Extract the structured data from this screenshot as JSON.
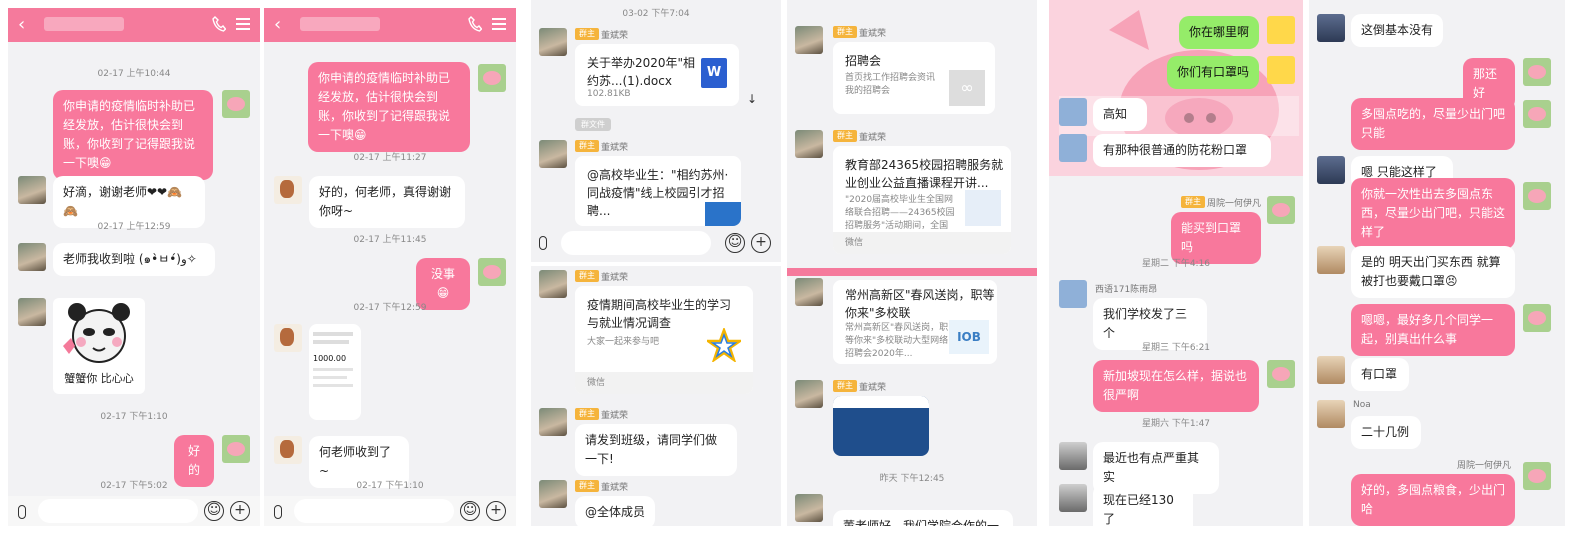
{
  "p1": {
    "t1": "02-17 上午10:44",
    "m1": "你申请的疫情临时补助已经发放，估计很快会到账，你收到了记得跟我说一下噢😁",
    "r1": "好滴，谢谢老师❤❤🙈🙈",
    "t2": "02-17 上午12:59",
    "r2": "老师我收到啦 (๑•̀ㅂ•́)و✧",
    "sticker": "蟹蟹你 比心心",
    "t3": "02-17 下午1:10",
    "m2": "好的",
    "t4": "02-17 下午5:02"
  },
  "p2": {
    "m1": "你申请的疫情临时补助已经发放，估计很快会到账，你收到了记得跟我说一下噢😁",
    "t1": "02-17 上午11:27",
    "r1": "好的，何老师，真得谢谢你呀~",
    "t2": "02-17 上午11:45",
    "m2": "没事😁",
    "t3": "02-17 下午12:59",
    "amount": "1000.00",
    "r2": "何老师收到了~",
    "t4": "02-17 下午1:10"
  },
  "p3": {
    "t0": "03-02 下午7:04",
    "badge": "群主",
    "name": "董斌荣",
    "file_title": "关于举办2020年\"相约苏...(1).docx",
    "file_size": "102.81KB",
    "file_tag": "群文件",
    "card1_title": "@高校毕业生：\"相约苏州·同战疫情\"线上校园引才招聘...",
    "card2_title": "疫情期间高校毕业生的学习与就业情况调查",
    "card2_desc": "大家一起来参与吧",
    "card2_foot": "微信",
    "m1": "请发到班级，请同学们做一下!",
    "m2": "@全体成员"
  },
  "p4": {
    "badge": "群主",
    "name": "董斌荣",
    "card1_title": "招聘会",
    "card1_desc": "首页找工作招聘会资讯 我的招聘会",
    "card2_title": "教育部24365校园招聘服务就业创业公益直播课程开讲...",
    "card2_desc": "\"2020届高校毕业生全国网络联合招聘——24365校园招聘服务\"活动期间，全国",
    "card2_foot": "微信",
    "card3_title": "常州高新区\"春风送岗，职等你来\"多校联",
    "card3_desc": "常州高新区\"春风送岗，职等你来\"多校联动大型网络招聘会2020年...",
    "ts": "昨天 下午12:45",
    "m_last": "董老师好，我们学院合作的一"
  },
  "p5": {
    "g1": "你在哪里啊",
    "g2": "你们有口罩吗",
    "w1": "高知",
    "w2": "有那种很普通的防花粉口罩",
    "sender1": "周院一何伊凡",
    "badge": "群主",
    "m1": "能买到口罩吗",
    "t1": "星期二 下午4:16",
    "sender2": "西语171陈雨昂",
    "r1": "我们学校发了三个",
    "t2": "星期三 下午6:21",
    "m2": "新加坡现在怎么样，据说也很严啊",
    "t3": "星期六 下午1:47",
    "r2": "最近也有点严重其实",
    "r3": "现在已经130了"
  },
  "p6": {
    "r1": "这倒基本没有",
    "m1": "那还好",
    "m2": "多囤点吃的，尽量少出门吧只能",
    "r2": "嗯 只能这样了",
    "m3": "你就一次性出去多囤点东西，尽量少出门吧，只能这样了",
    "r3": "是的 明天出门买东西 就算被打也要戴口罩😣",
    "m4": "嗯嗯，最好多几个同学一起，别真出什么事",
    "r4": "有口罩",
    "sender": "Noa",
    "r5": "二十几例",
    "sender2": "周院一何伊凡",
    "m5": "好的，多囤点粮食，少出门哈"
  }
}
